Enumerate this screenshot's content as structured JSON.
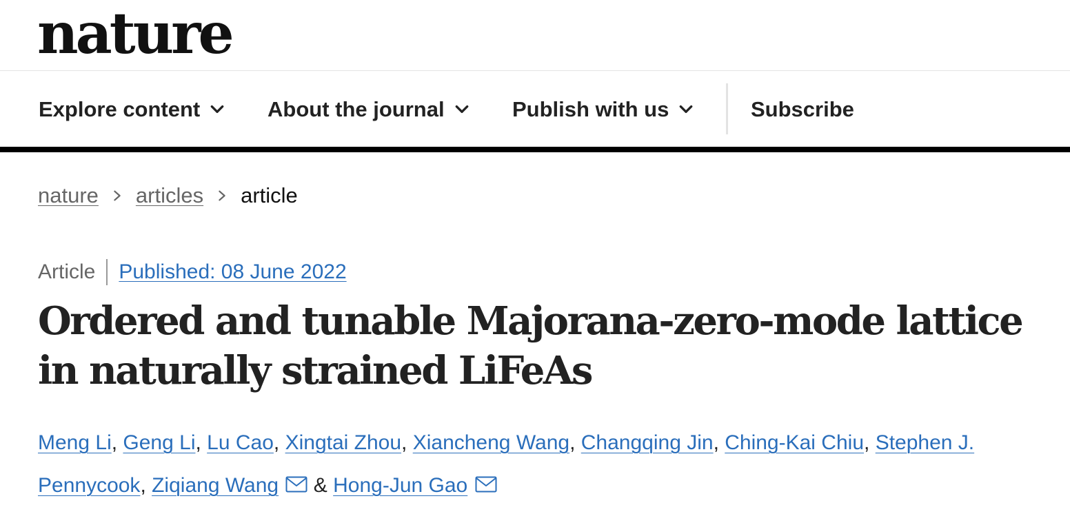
{
  "header": {
    "logo": "nature"
  },
  "nav": {
    "items": [
      {
        "label": "Explore content",
        "icon": "chevron-down-icon"
      },
      {
        "label": "About the journal",
        "icon": "chevron-down-icon"
      },
      {
        "label": "Publish with us",
        "icon": "chevron-down-icon"
      },
      {
        "label": "Subscribe"
      }
    ]
  },
  "breadcrumb": {
    "items": [
      "nature",
      "articles",
      "article"
    ],
    "separator_icon": "chevron-right-icon"
  },
  "article": {
    "type": "Article",
    "published": "Published: 08 June 2022",
    "title": "Ordered and tunable Majorana-zero-mode lattice in naturally strained LiFeAs",
    "authors": [
      "Meng Li",
      "Geng Li",
      "Lu Cao",
      "Xingtai Zhou",
      "Xiancheng Wang",
      "Changqing Jin",
      "Ching-Kai Chiu",
      "Stephen J. Pennycook",
      "Ziqiang Wang",
      "Hong-Jun Gao"
    ],
    "author_separator": ", ",
    "last_separator": " & ",
    "corresponding_icon": "mail-icon"
  },
  "colors": {
    "link": "#2a6ebb",
    "text": "#222222",
    "muted": "#666666",
    "rule": "#000000"
  }
}
